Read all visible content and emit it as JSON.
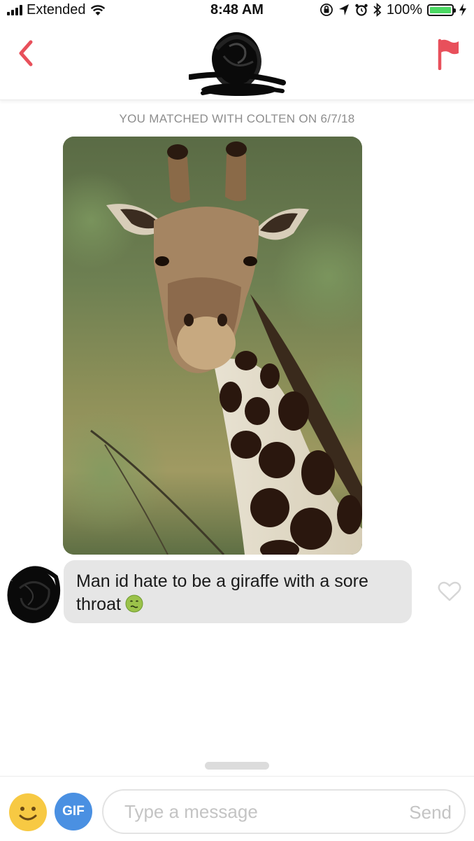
{
  "status_bar": {
    "carrier": "Extended",
    "time": "8:48 AM",
    "battery_percent": "100%",
    "battery_level": 1.0,
    "battery_color": "#4cd964"
  },
  "header": {
    "back_icon": "chevron-left-icon",
    "report_icon": "flag-icon",
    "accent_color": "#e8505b"
  },
  "chat": {
    "match_notice": "YOU MATCHED WITH COLTEN ON 6/7/18",
    "photo_subject": "giraffe",
    "messages": [
      {
        "text": "Man id hate to be a giraffe with a sore throat",
        "emoji": "nauseated-face-emoji",
        "liked": false
      }
    ]
  },
  "composer": {
    "emoji_icon": "smiley-icon",
    "gif_label": "GIF",
    "gif_color": "#4a90e2",
    "placeholder": "Type a message",
    "value": "",
    "send_label": "Send"
  }
}
